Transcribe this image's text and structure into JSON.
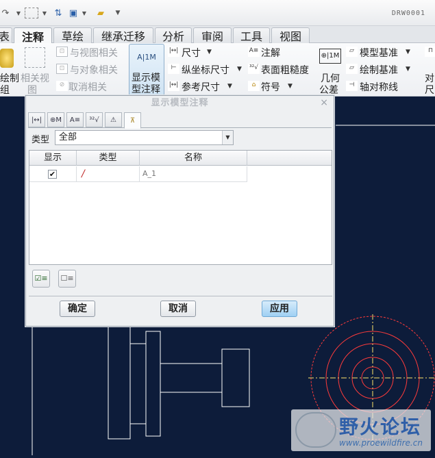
{
  "colors": {
    "canvas": "#0d1c3a",
    "drawing_line": "#ffffff",
    "circle": "#ff3b3b",
    "centerline": "#ffe36a",
    "watermark_text": "#2f5fa8"
  },
  "toolbar": {
    "doc_title": "DRW0001"
  },
  "tabs": [
    {
      "label": "表",
      "active": false
    },
    {
      "label": "注释",
      "active": true
    },
    {
      "label": "草绘",
      "active": false
    },
    {
      "label": "继承迁移",
      "active": false
    },
    {
      "label": "分析",
      "active": false
    },
    {
      "label": "审阅",
      "active": false
    },
    {
      "label": "工具",
      "active": false
    },
    {
      "label": "视图",
      "active": false
    }
  ],
  "ribbon": {
    "draw_group_line1": "绘制",
    "draw_group_line2": "组",
    "related_view_line1": "相关视",
    "related_view_line2": "图",
    "relate_to_view": "与视图相关",
    "relate_to_object": "与对象相关",
    "cancel_relate": "取消相关",
    "show_model_annotations_line1": "显示模",
    "show_model_annotations_line2": "型注释",
    "dimension": "尺寸",
    "ordinate_dimension": "纵坐标尺寸",
    "reference_dimension": "参考尺寸",
    "note": "注解",
    "surface_finish": "表面粗糙度",
    "symbol": "符号",
    "geometric_tolerance_line1": "几何",
    "geometric_tolerance_line2": "公差",
    "model_datum": "模型基准",
    "draw_datum": "绘制基准",
    "axis_symmetry": "轴对称线",
    "right_clipped_line1": "对",
    "right_clipped_line2": "尺"
  },
  "dialog": {
    "title": "显示模型注释",
    "type_label": "类型",
    "type_value": "全部",
    "columns": [
      "显示",
      "类型",
      "名称"
    ],
    "rows": [
      {
        "name": "A_1",
        "checked": true
      }
    ],
    "ok": "确定",
    "cancel": "取消",
    "apply": "应用"
  },
  "watermark": {
    "title": "野火论坛",
    "url": "www.proewildfire.cn"
  }
}
